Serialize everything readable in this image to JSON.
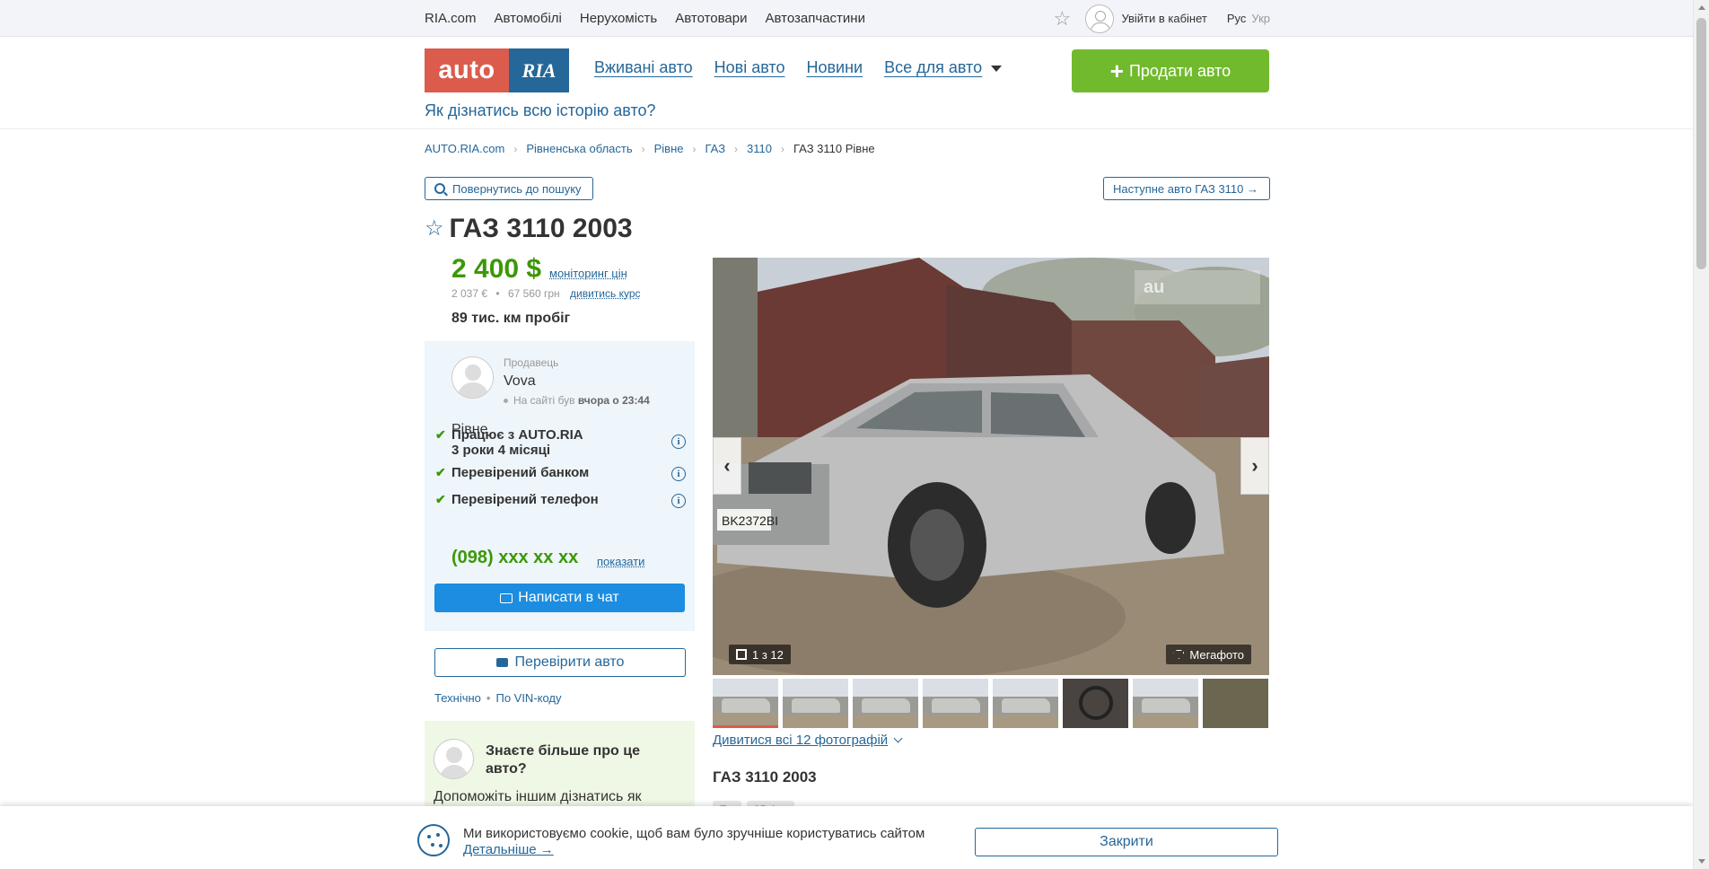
{
  "topbar": {
    "nav": [
      "RIA.com",
      "Автомобілі",
      "Нерухомість",
      "Автотовари",
      "Автозапчастини"
    ],
    "login": "Увійти в кабінет",
    "lang_ru": "Рус",
    "lang_ua": "Укр"
  },
  "header": {
    "logo_auto": "auto",
    "logo_ria": "RIA",
    "nav": [
      "Вживані авто",
      "Нові авто",
      "Новини",
      "Все для авто"
    ],
    "sell_label": "Продати авто",
    "history_link": "Як дізнатись всю історію авто?"
  },
  "breadcrumb": [
    "AUTO.RIA.com",
    "Рівненська область",
    "Рівне",
    "ГАЗ",
    "3110",
    "ГАЗ 3110 Рівне"
  ],
  "actions": {
    "back": "Повернутись до пошуку",
    "next": "Наступне авто ГАЗ 3110 →"
  },
  "listing": {
    "title": "ГАЗ 3110 2003",
    "price_usd": "2 400 $",
    "monitor_link": "моніторинг цін",
    "price_eur": "2 037 €",
    "price_uah": "67 560 грн",
    "price_sep": "•",
    "course_link": "дивитись курс",
    "mileage": "89 тис. км пробіг"
  },
  "seller": {
    "label": "Продавець",
    "name": "Vova",
    "online_prefix": "На сайті був",
    "online_time": "вчора о 23:44",
    "city": "Рівне",
    "checks": [
      {
        "line1": "Працює з AUTO.RIA",
        "line2": "3 роки 4 місяці"
      },
      {
        "line1": "Перевірений банком"
      },
      {
        "line1": "Перевірений телефон"
      }
    ],
    "phone": "(098) xxx xx xx",
    "show_link": "показати",
    "chat_label": "Написати в чат"
  },
  "check_car": {
    "label": "Перевірити авто",
    "link_tech": "Технічно",
    "link_sep": "•",
    "link_vin": "По VIN-коду"
  },
  "know_more": {
    "title": "Знаєте більше про це авто?",
    "text": "Допоможіть іншим дізнатись як"
  },
  "gallery": {
    "counter": "1 з 12",
    "mega": "Мегафото",
    "watermark": "au",
    "prev": "‹",
    "next": "›",
    "all_photos": "Дивитися всі 12 фотографій"
  },
  "details": {
    "subtitle": "ГАЗ 3110 2003",
    "tags": [
      "Т...",
      "35 ф..."
    ]
  },
  "cookie": {
    "text": "Ми використовуємо cookie, щоб вам було зручніше користуватись сайтом",
    "more": "Детальніше →",
    "close": "Закрити"
  },
  "colors": {
    "brand_blue": "#256799",
    "brand_red": "#db5c4c",
    "green": "#72ba2d",
    "price_green": "#3c9806",
    "chat_blue": "#1c8de0"
  }
}
